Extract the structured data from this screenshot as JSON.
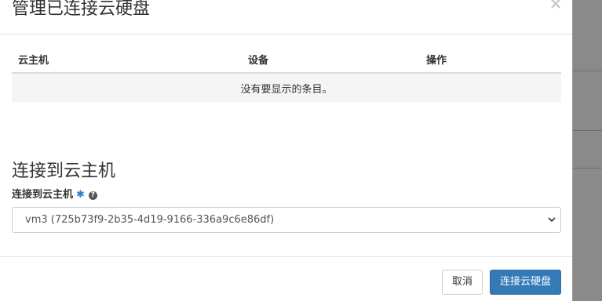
{
  "modal": {
    "title": "管理已连接云硬盘",
    "close_glyph": "×"
  },
  "table": {
    "columns": [
      "云主机",
      "设备",
      "操作"
    ],
    "empty_message": "没有要显示的条目。"
  },
  "attach_section": {
    "title": "连接到云主机",
    "field_label": "连接到云主机",
    "required_mark": "✱",
    "help_glyph": "?",
    "selected_instance": "vm3 (725b73f9-2b35-4d19-9166-336a9c6e86df)"
  },
  "footer": {
    "cancel_label": "取消",
    "submit_label": "连接云硬盘"
  },
  "colors": {
    "primary": "#337ab7",
    "required": "#2a7fd4"
  }
}
